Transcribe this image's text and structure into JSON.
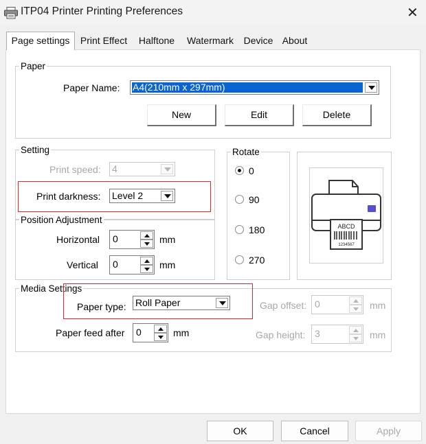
{
  "window": {
    "title": "ITP04 Printer Printing Preferences",
    "close_icon": "close-icon",
    "app_icon": "printer-icon"
  },
  "tabs": [
    {
      "label": "Page settings",
      "active": true
    },
    {
      "label": "Print Effect",
      "active": false
    },
    {
      "label": "Halftone",
      "active": false
    },
    {
      "label": "Watermark",
      "active": false
    },
    {
      "label": "Device",
      "active": false
    },
    {
      "label": "About",
      "active": false
    }
  ],
  "paper": {
    "legend": "Paper",
    "name_label": "Paper Name:",
    "name_value": "A4(210mm x 297mm)",
    "new_label": "New",
    "edit_label": "Edit",
    "delete_label": "Delete"
  },
  "setting": {
    "legend": "Setting",
    "speed_label": "Print speed:",
    "speed_value": "4",
    "darkness_label": "Print darkness:",
    "darkness_value": "Level 2"
  },
  "rotate": {
    "legend": "Rotate",
    "options": [
      "0",
      "90",
      "180",
      "270"
    ],
    "selected": "0"
  },
  "preview": {
    "label_text": "ABCD",
    "barcode_text": "1234567"
  },
  "position": {
    "legend": "Position Adjustment",
    "horizontal_label": "Horizontal",
    "horizontal_value": "0",
    "vertical_label": "Vertical",
    "vertical_value": "0",
    "unit": "mm"
  },
  "media": {
    "legend": "Media Settings",
    "paper_type_label": "Paper type:",
    "paper_type_value": "Roll Paper",
    "feed_label": "Paper feed after",
    "feed_value": "0",
    "gap_offset_label": "Gap offset:",
    "gap_offset_value": "0",
    "gap_height_label": "Gap height:",
    "gap_height_value": "3",
    "unit": "mm"
  },
  "footer": {
    "ok_label": "OK",
    "cancel_label": "Cancel",
    "apply_label": "Apply"
  },
  "colors": {
    "highlight": "#0a64d2",
    "callout_red": "#d9282f",
    "accent_purple": "#5b4fd1"
  }
}
